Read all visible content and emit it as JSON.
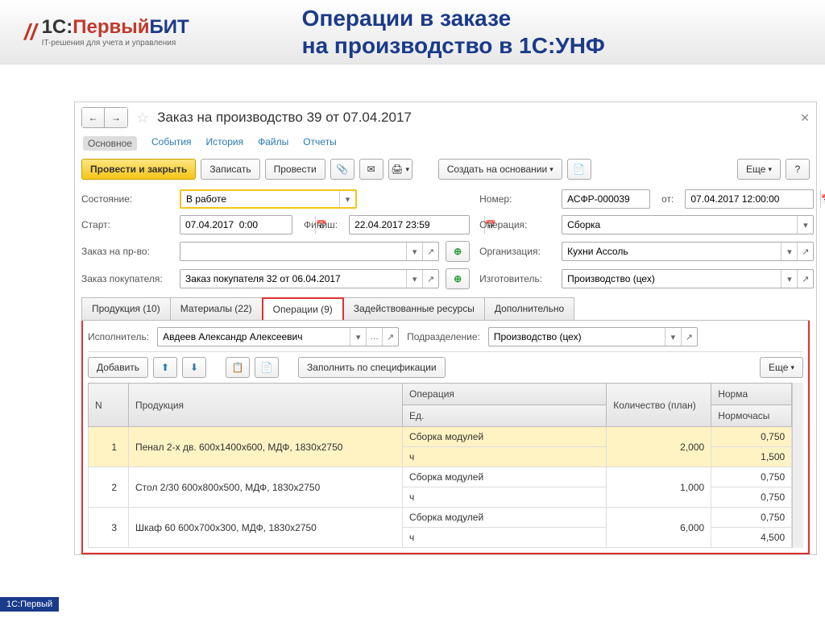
{
  "header": {
    "logo_brand": "1С:",
    "logo_first": "Первый",
    "logo_bit": "БИТ",
    "logo_sub": "IT-решения для учета и управления",
    "slide_title_l1": "Операции в заказе",
    "slide_title_l2": "на производство в 1С:УНФ"
  },
  "window": {
    "title": "Заказ на производство 39 от 07.04.2017",
    "links": {
      "main": "Основное",
      "events": "События",
      "history": "История",
      "files": "Файлы",
      "reports": "Отчеты"
    },
    "toolbar": {
      "post_close": "Провести и закрыть",
      "save": "Записать",
      "post": "Провести",
      "create_based": "Создать на основании",
      "more": "Еще",
      "help": "?"
    },
    "fields": {
      "state_lbl": "Состояние:",
      "state_val": "В работе",
      "start_lbl": "Старт:",
      "start_val": "07.04.2017  0:00",
      "finish_lbl": "Финиш:",
      "finish_val": "22.04.2017 23:59",
      "order_prod_lbl": "Заказ на пр-во:",
      "order_prod_val": "",
      "order_cust_lbl": "Заказ покупателя:",
      "order_cust_val": "Заказ покупателя 32 от 06.04.2017",
      "number_lbl": "Номер:",
      "number_val": "АСФР-000039",
      "from_lbl": "от:",
      "from_val": "07.04.2017 12:00:00",
      "operation_lbl": "Операция:",
      "operation_val": "Сборка",
      "org_lbl": "Организация:",
      "org_val": "Кухни Ассоль",
      "maker_lbl": "Изготовитель:",
      "maker_val": "Производство (цех)"
    },
    "tabs": {
      "products": "Продукция (10)",
      "materials": "Материалы (22)",
      "operations": "Операции (9)",
      "resources": "Задействованные ресурсы",
      "extra": "Дополнительно"
    },
    "ops_panel": {
      "executor_lbl": "Исполнитель:",
      "executor_val": "Авдеев Александр Алексеевич",
      "dept_lbl": "Подразделение:",
      "dept_val": "Производство (цех)",
      "add_btn": "Добавить",
      "fill_btn": "Заполнить по спецификации",
      "more_btn": "Еще"
    },
    "table": {
      "h_n": "N",
      "h_product": "Продукция",
      "h_operation": "Операция",
      "h_unit": "Ед.",
      "h_qty": "Количество (план)",
      "h_norm": "Норма",
      "h_hours": "Нормочасы",
      "rows": [
        {
          "n": "1",
          "product": "Пенал 2-х дв. 600х1400х600, МДФ, 1830х2750",
          "op": "Сборка модулей",
          "qty": "2,000",
          "norm": "0,750",
          "unit": "ч",
          "hours": "1,500"
        },
        {
          "n": "2",
          "product": "Стол 2/30 600х800х500, МДФ, 1830х2750",
          "op": "Сборка модулей",
          "qty": "1,000",
          "norm": "0,750",
          "unit": "ч",
          "hours": "0,750"
        },
        {
          "n": "3",
          "product": "Шкаф 60 600х700х300, МДФ, 1830х2750",
          "op": "Сборка модулей",
          "qty": "6,000",
          "norm": "0,750",
          "unit": "ч",
          "hours": "4,500"
        }
      ]
    }
  },
  "footer_tag": "1С:Первый"
}
